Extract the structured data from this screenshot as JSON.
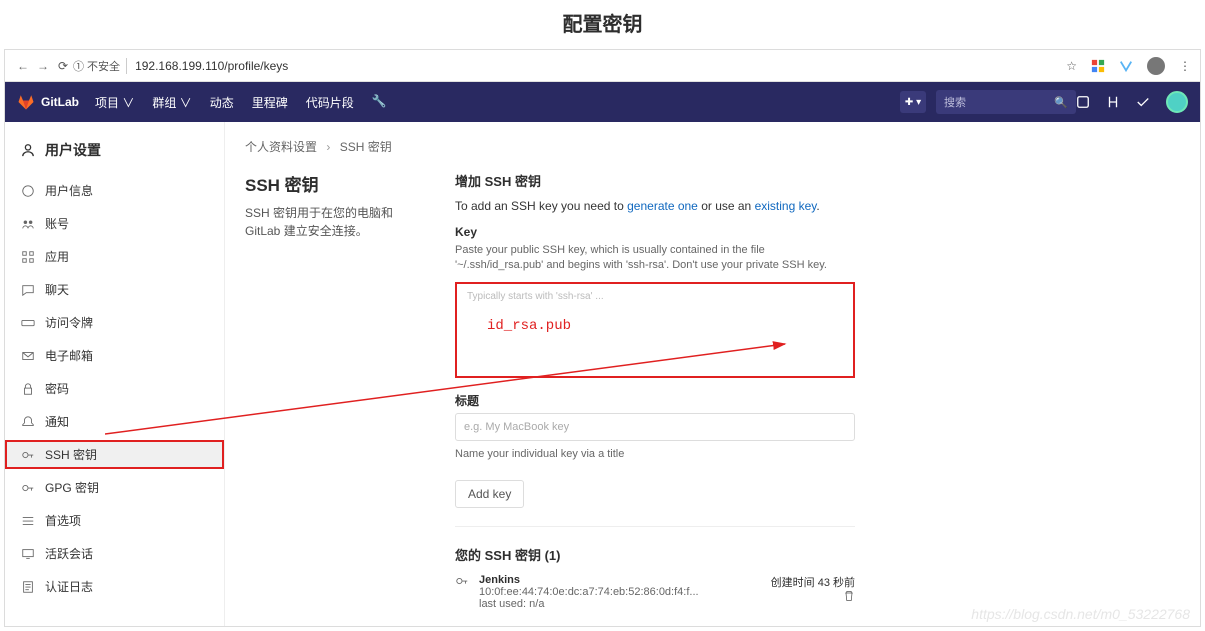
{
  "page_title_top": "配置密钥",
  "browser": {
    "insecure": "① 不安全",
    "url": "192.168.199.110/profile/keys"
  },
  "nav": {
    "brand": "GitLab",
    "menu": [
      "项目 ∨",
      "群组 ∨",
      "动态",
      "里程碑",
      "代码片段"
    ],
    "search_placeholder": "搜索"
  },
  "sidebar": {
    "header": "用户设置",
    "items": [
      {
        "label": "用户信息"
      },
      {
        "label": "账号"
      },
      {
        "label": "应用"
      },
      {
        "label": "聊天"
      },
      {
        "label": "访问令牌"
      },
      {
        "label": "电子邮箱"
      },
      {
        "label": "密码"
      },
      {
        "label": "通知"
      },
      {
        "label": "SSH 密钥",
        "active": true
      },
      {
        "label": "GPG 密钥"
      },
      {
        "label": "首选项"
      },
      {
        "label": "活跃会话"
      },
      {
        "label": "认证日志"
      }
    ]
  },
  "breadcrumb": {
    "a": "个人资料设置",
    "b": "SSH 密钥"
  },
  "left": {
    "title": "SSH 密钥",
    "desc": "SSH 密钥用于在您的电脑和 GitLab 建立安全连接。"
  },
  "form": {
    "heading": "增加 SSH 密钥",
    "intro_pre": "To add an SSH key you need to ",
    "link1": "generate one",
    "intro_mid": " or use an ",
    "link2": "existing key",
    "intro_post": ".",
    "key_label": "Key",
    "key_hint": "Paste your public SSH key, which is usually contained in the file '~/.ssh/id_rsa.pub' and begins with 'ssh-rsa'. Don't use your private SSH key.",
    "key_placeholder": "Typically starts with 'ssh-rsa' ...",
    "overlay": "id_rsa.pub",
    "title_label": "标题",
    "title_placeholder": "e.g. My MacBook key",
    "title_hint": "Name your individual key via a title",
    "add_btn": "Add key"
  },
  "keys": {
    "heading": "您的 SSH 密钥 (1)",
    "item": {
      "name": "Jenkins",
      "fingerprint": "10:0f:ee:44:74:0e:dc:a7:74:eb:52:86:0d:f4:f...",
      "last_used": "last used: n/a",
      "created": "创建时间 43 秒前"
    }
  },
  "watermark": "https://blog.csdn.net/m0_53222768"
}
